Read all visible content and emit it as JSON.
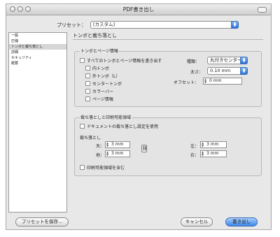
{
  "window": {
    "title": "PDF書き出し"
  },
  "preset": {
    "label": "プリセット：",
    "value": "[カスタム]"
  },
  "sidebar": {
    "items": [
      {
        "label": "一般"
      },
      {
        "label": "圧縮"
      },
      {
        "label": "トンボと裁ち落とし",
        "selected": true
      },
      {
        "label": "詳細"
      },
      {
        "label": "セキュリティ"
      },
      {
        "label": "概要"
      }
    ]
  },
  "main": {
    "section_title": "トンボと裁ち落とし",
    "marks": {
      "group_label": "トンボとページ情報",
      "all_marks": "すべてのトンボとページ情報を書き出す",
      "crop_marks": "内トンボ",
      "bleed_marks": "外トンボ（L）",
      "registration_marks": "センタートンボ",
      "color_bars": "カラーバー",
      "page_info": "ページ情報",
      "type_label": "種類：",
      "type_value": "丸付きセンター",
      "weight_label": "太さ：",
      "weight_value": "0.10 mm",
      "offset_label": "オフセット：",
      "offset_value": "0 mm"
    },
    "bleed": {
      "group_label": "裁ち落としと印刷可能領域",
      "use_doc_bleed": "ドキュメントの裁ち落とし設定を使用",
      "bleed_label": "裁ち落とし",
      "top_label": "天：",
      "top_value": "3 mm",
      "bottom_label": "地：",
      "bottom_value": "3 mm",
      "left_label": "左：",
      "left_value": "3 mm",
      "right_label": "右：",
      "right_value": "3 mm",
      "include_slug": "印刷可能領域を含む"
    }
  },
  "footer": {
    "save_preset": "プリセットを保存...",
    "cancel": "キャンセル",
    "export": "書き出し"
  },
  "colors": {
    "accent": "#3d86e8",
    "dialog_bg": "#e8e8e8"
  }
}
